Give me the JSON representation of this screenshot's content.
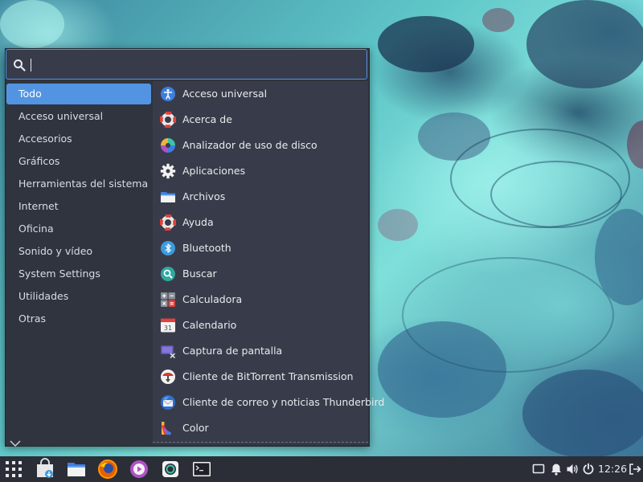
{
  "search": {
    "value": "",
    "placeholder": ""
  },
  "categories": [
    {
      "label": "Todo",
      "active": true
    },
    {
      "label": "Acceso universal"
    },
    {
      "label": "Accesorios"
    },
    {
      "label": "Gráficos"
    },
    {
      "label": "Herramientas del sistema"
    },
    {
      "label": "Internet"
    },
    {
      "label": "Oficina"
    },
    {
      "label": "Sonido y vídeo"
    },
    {
      "label": "System Settings"
    },
    {
      "label": "Utilidades"
    },
    {
      "label": "Otras"
    }
  ],
  "apps": [
    {
      "label": "Acceso universal",
      "icon": "accessibility-icon"
    },
    {
      "label": "Acerca de",
      "icon": "lifebuoy-icon"
    },
    {
      "label": "Analizador de uso de disco",
      "icon": "disk-usage-icon"
    },
    {
      "label": "Aplicaciones",
      "icon": "gear-icon"
    },
    {
      "label": "Archivos",
      "icon": "folder-icon"
    },
    {
      "label": "Ayuda",
      "icon": "lifebuoy-icon"
    },
    {
      "label": "Bluetooth",
      "icon": "bluetooth-icon"
    },
    {
      "label": "Buscar",
      "icon": "search-icon"
    },
    {
      "label": "Calculadora",
      "icon": "calculator-icon"
    },
    {
      "label": "Calendario",
      "icon": "calendar-icon",
      "calendar_day": "31"
    },
    {
      "label": "Captura de pantalla",
      "icon": "screenshot-icon"
    },
    {
      "label": "Cliente de BitTorrent Transmission",
      "icon": "transmission-icon"
    },
    {
      "label": "Cliente de correo y noticias Thunderbird",
      "icon": "thunderbird-icon"
    },
    {
      "label": "Color",
      "icon": "color-icon"
    }
  ],
  "panel": {
    "launchers": [
      {
        "name": "app-menu-button",
        "icon": "apps-grid-icon"
      },
      {
        "name": "software-store-launcher",
        "icon": "software-store-icon"
      },
      {
        "name": "files-launcher",
        "icon": "folder-icon"
      },
      {
        "name": "firefox-launcher",
        "icon": "firefox-icon"
      },
      {
        "name": "media-player-launcher",
        "icon": "media-player-icon"
      },
      {
        "name": "screenshot-launcher",
        "icon": "camera-icon"
      },
      {
        "name": "terminal-launcher",
        "icon": "terminal-icon"
      }
    ],
    "tray": [
      "display-icon",
      "bell-icon",
      "volume-icon",
      "power-icon"
    ],
    "clock": "12:26",
    "logout_icon": "logout-icon"
  },
  "colors": {
    "accent": "#5294e2",
    "menu_bg": "#2f343f",
    "apps_bg": "#383c4a",
    "panel_bg": "#2b2e37"
  }
}
